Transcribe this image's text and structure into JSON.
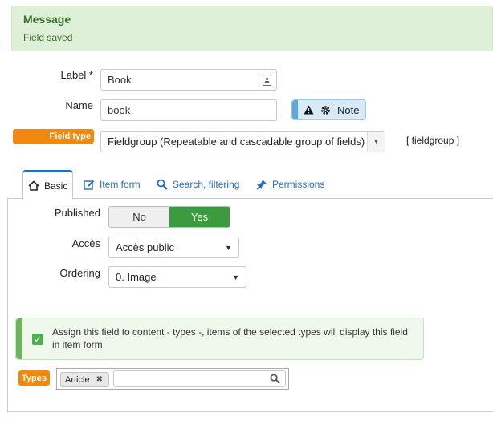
{
  "message": {
    "title": "Message",
    "text": "Field saved"
  },
  "form": {
    "label_label": "Label *",
    "label_value": "Book",
    "name_label": "Name",
    "name_value": "book",
    "note_label": "Note",
    "field_type_label": "Field type",
    "field_type_value": "Fieldgroup (Repeatable and cascadable group of fields)",
    "field_type_code": "[ fieldgroup ]"
  },
  "tabs": [
    {
      "label": "Basic",
      "icon": "home-icon",
      "active": true
    },
    {
      "label": "Item form",
      "icon": "edit-icon",
      "active": false
    },
    {
      "label": "Search, filtering",
      "icon": "search-icon",
      "active": false
    },
    {
      "label": "Permissions",
      "icon": "pin-icon",
      "active": false
    }
  ],
  "basic": {
    "published_label": "Published",
    "published_no": "No",
    "published_yes": "Yes",
    "published_value": "Yes",
    "acces_label": "Accès",
    "acces_value": "Accès public",
    "ordering_label": "Ordering",
    "ordering_value": "0. Image"
  },
  "assign": {
    "checked": true,
    "text": "Assign this field to content - types -, items of the selected types will display this field in item form"
  },
  "types": {
    "label": "Types",
    "selected": [
      "Article"
    ],
    "remove_glyph": "✖",
    "search_placeholder": ""
  },
  "colors": {
    "accent": "#2a6db5",
    "success": "#3e9a3e",
    "orange": "#f0890e",
    "message_bg": "#dff0d8",
    "note_bg": "#d8eaf6"
  }
}
